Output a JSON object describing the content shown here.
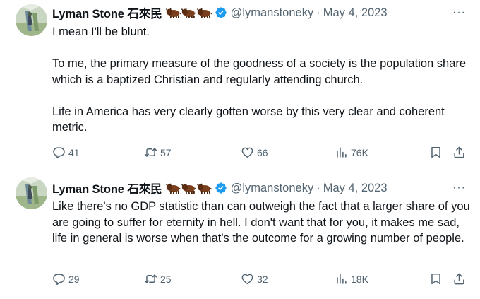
{
  "tweets": [
    {
      "author_name": "Lyman Stone 石來民",
      "handle": "@lymanstoneky",
      "separator": "·",
      "date": "May 4, 2023",
      "emoji": [
        "bison",
        "bison",
        "bison"
      ],
      "text": "I mean I'll be blunt.\n\nTo me, the primary measure of the goodness of a society is the population share which is a baptized Christian and regularly attending church.\n\nLife in America has very clearly gotten worse by this very clear and coherent metric.",
      "replies": "41",
      "reposts": "57",
      "likes": "66",
      "views": "76K"
    },
    {
      "author_name": "Lyman Stone 石來民",
      "handle": "@lymanstoneky",
      "separator": "·",
      "date": "May 4, 2023",
      "emoji": [
        "bison",
        "bison",
        "bison"
      ],
      "text": "Like there's no GDP statistic than can outweigh the fact that a larger share of you are going to suffer for eternity in hell. I don't want that for you, it makes me sad, life in general is worse when that's the outcome for a growing number of people.",
      "replies": "29",
      "reposts": "25",
      "likes": "32",
      "views": "18K"
    }
  ],
  "icons": {
    "verified": "verified-badge-icon",
    "more": "more-horizontal-icon",
    "reply": "speech-bubble-icon",
    "repost": "repost-arrows-icon",
    "like": "heart-icon",
    "views": "bar-chart-icon",
    "bookmark": "bookmark-icon",
    "share": "share-upload-icon"
  },
  "more_glyph": "···",
  "colors": {
    "verified": "#1d9bf0",
    "secondary_text": "#536471",
    "text": "#0f1419"
  }
}
